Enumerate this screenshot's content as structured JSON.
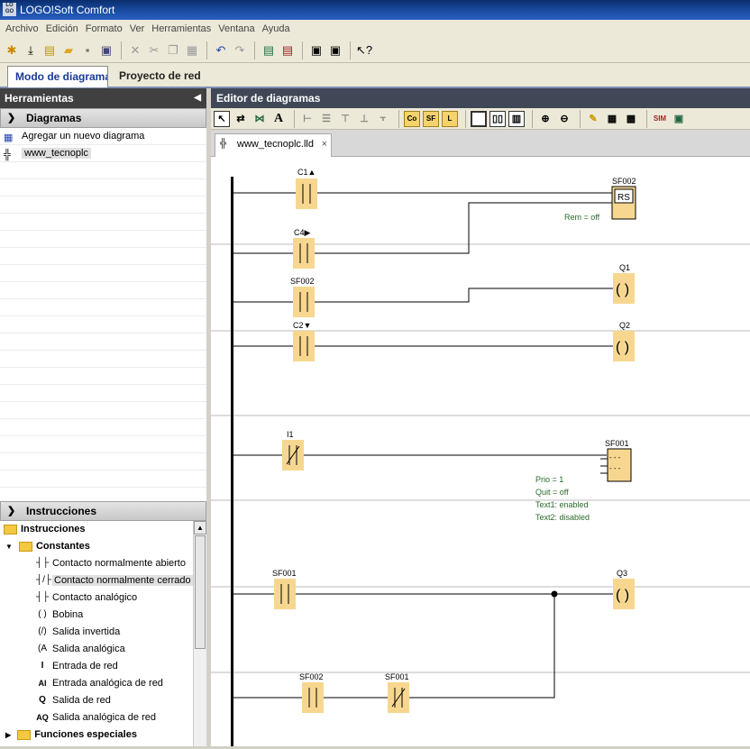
{
  "app": {
    "title": "LOGO!Soft Comfort",
    "logo_text": "LOGO Soft"
  },
  "menu": [
    "Archivo",
    "Edición",
    "Formato",
    "Ver",
    "Herramientas",
    "Ventana",
    "Ayuda"
  ],
  "tabs": {
    "diagram_mode": "Modo de diagrama",
    "network_project": "Proyecto de red"
  },
  "left": {
    "tools_title": "Herramientas",
    "diagrams_header": "Diagramas",
    "add_diagram": "Agregar un nuevo diagrama",
    "diagram_item": "www_tecnoplc",
    "instructions_header": "Instrucciones",
    "tree": {
      "root": "Instrucciones",
      "constants": "Constantes",
      "items": [
        {
          "label": "Contacto normalmente abierto",
          "icon": "-| |-"
        },
        {
          "label": "Contacto normalmente cerrado",
          "icon": "-|/|-"
        },
        {
          "label": "Contacto analógico",
          "icon": "-|A|-"
        },
        {
          "label": "Bobina",
          "icon": "-( )"
        },
        {
          "label": "Salida invertida",
          "icon": "-(/)"
        },
        {
          "label": "Salida analógica",
          "icon": "-(A)"
        },
        {
          "label": "Entrada de red",
          "icon": "I"
        },
        {
          "label": "Entrada analógica de red",
          "icon": "AI"
        },
        {
          "label": "Salida de red",
          "icon": "Q"
        },
        {
          "label": "Salida analógica de red",
          "icon": "AQ"
        }
      ],
      "special": "Funciones especiales"
    }
  },
  "editor": {
    "title": "Editor de diagramas",
    "file_tab": "www_tecnoplc.lld",
    "close": "×"
  },
  "ladder": {
    "labels": {
      "c1": "C1▲",
      "c4": "C4▶",
      "sf002a": "SF002",
      "c2": "C2▼",
      "i1": "I1",
      "sf001a": "SF001",
      "sf002b": "SF002",
      "sf001b": "SF001",
      "rs_block": "SF002",
      "rs_text": "RS",
      "rem": "Rem = off",
      "q1": "Q1",
      "q2": "Q2",
      "q3": "Q3",
      "msg_block": "SF001",
      "prio": "Prio = 1",
      "quit": "Quit = off",
      "text1": "Text1: enabled",
      "text2": "Text2: disabled",
      "coil": "( )",
      "msg_lines": "- - -"
    }
  },
  "colors": {
    "contact_fill": "#f7d790",
    "comment_green": "#2a6a2a",
    "header_dark": "#404040"
  }
}
